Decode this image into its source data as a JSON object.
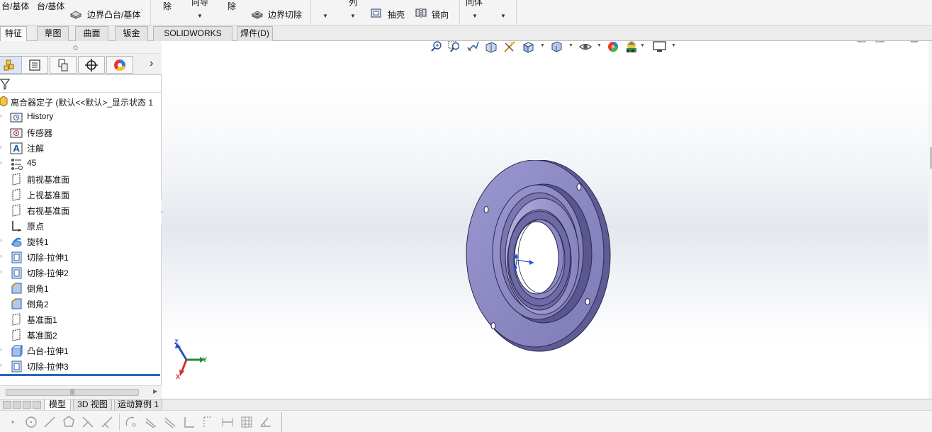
{
  "ribbon": {
    "label_boss_base_1": "台/基体",
    "label_boss_base_2": "台/基体",
    "label_boundary_boss": "边界凸台/基体",
    "label_remove_1": "除",
    "label_guide": "向导",
    "label_remove_2": "除",
    "label_boundary_cut": "边界切除",
    "label_array": "列",
    "label_shell": "抽壳",
    "label_mirror": "镜向",
    "label_intersect": "同体"
  },
  "tabs": [
    {
      "label": "特征",
      "active": true
    },
    {
      "label": "草图"
    },
    {
      "label": "曲面"
    },
    {
      "label": "钣金"
    },
    {
      "label": "SOLIDWORKS MBD"
    },
    {
      "label": "焊件(D)"
    }
  ],
  "panel": {
    "tabs": [
      {
        "icon": "feature-manager-icon",
        "active": true
      },
      {
        "icon": "property-manager-icon"
      },
      {
        "icon": "configuration-manager-icon"
      },
      {
        "icon": "dimxpert-manager-icon"
      },
      {
        "icon": "display-manager-icon"
      }
    ],
    "more": "›",
    "root": "离合器定子  (默认<<默认>_显示状态 1",
    "items": [
      {
        "label": "History",
        "icon": "history-folder-icon",
        "expand": true
      },
      {
        "label": "传感器",
        "icon": "sensor-folder-icon",
        "expand": false
      },
      {
        "label": "注解",
        "icon": "annotations-icon",
        "expand": true
      },
      {
        "label": "45",
        "icon": "equations-icon",
        "expand": true
      },
      {
        "label": "前视基准面",
        "icon": "plane-icon",
        "expand": false
      },
      {
        "label": "上视基准面",
        "icon": "plane-icon",
        "expand": false
      },
      {
        "label": "右视基准面",
        "icon": "plane-icon",
        "expand": false
      },
      {
        "label": "原点",
        "icon": "origin-icon",
        "expand": false
      },
      {
        "label": "旋转1",
        "icon": "revolve-icon",
        "expand": true
      },
      {
        "label": "切除-拉伸1",
        "icon": "cut-extrude-icon",
        "expand": true
      },
      {
        "label": "切除-拉伸2",
        "icon": "cut-extrude-icon",
        "expand": true
      },
      {
        "label": "倒角1",
        "icon": "chamfer-icon",
        "expand": false
      },
      {
        "label": "倒角2",
        "icon": "chamfer-icon",
        "expand": false
      },
      {
        "label": "基准面1",
        "icon": "plane-icon",
        "expand": false
      },
      {
        "label": "基准面2",
        "icon": "plane-icon",
        "expand": false
      },
      {
        "label": "凸台-拉伸1",
        "icon": "boss-extrude-icon",
        "expand": true
      },
      {
        "label": "切除-拉伸3",
        "icon": "cut-extrude-icon",
        "expand": true
      }
    ],
    "scroll_thumb_text": "|||"
  },
  "viewport": {
    "triad": {
      "x": "X",
      "y": "Y",
      "z": "Z"
    },
    "part_color": "#8a86c0",
    "part_dark": "#4e4b80"
  },
  "bottom_tabs": [
    {
      "label": "模型",
      "active": true
    },
    {
      "label": "3D 视图"
    },
    {
      "label": "运动算例 1"
    }
  ]
}
